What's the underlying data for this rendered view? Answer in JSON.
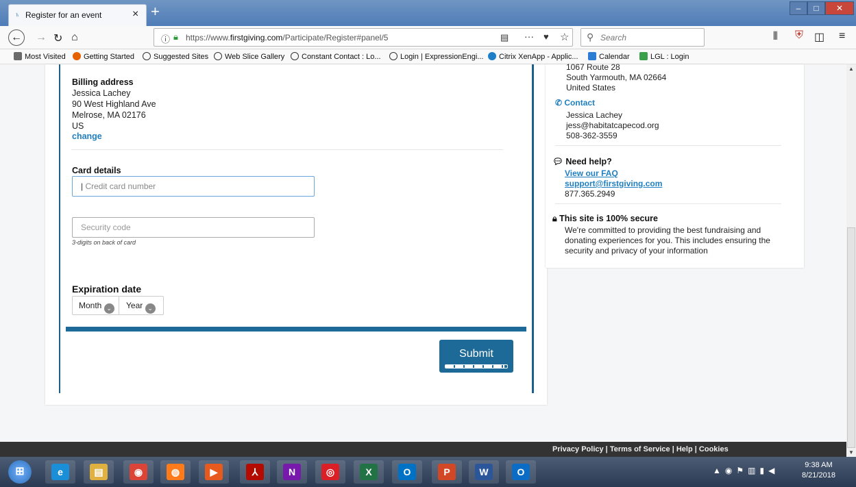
{
  "browser": {
    "tab_title": "Register for an event",
    "tab_close": "×",
    "new_tab": "+",
    "window_buttons": [
      "–",
      "□",
      "✕"
    ],
    "url_prefix": "https://www.",
    "url_domain": "firstgiving.com",
    "url_path": "/Participate/Register#panel/5",
    "search_placeholder": "Search",
    "nav_icons": [
      "back-icon",
      "forward-icon",
      "reload-icon",
      "home-icon"
    ]
  },
  "bookmarks": [
    {
      "label": "Most Visited",
      "color": "#6a6a6a"
    },
    {
      "label": "Getting Started",
      "color": "#e66000"
    },
    {
      "label": "Suggested Sites",
      "color": "#333333"
    },
    {
      "label": "Web Slice Gallery",
      "color": "#333333"
    },
    {
      "label": "Constant Contact : Lo...",
      "color": "#333333"
    },
    {
      "label": "Login | ExpressionEngi...",
      "color": "#333333"
    },
    {
      "label": "Citrix XenApp - Applic...",
      "color": "#1e7fc8"
    },
    {
      "label": "Calendar",
      "color": "#2b7cd3"
    },
    {
      "label": "LGL : Login",
      "color": "#3aa04a"
    }
  ],
  "billing": {
    "heading": "Billing address",
    "name": "Jessica Lachey",
    "street": "90 West Highland Ave",
    "city": "Melrose, MA 02176",
    "country": "US",
    "change_link": "change"
  },
  "card": {
    "heading": "Card details",
    "card_placeholder": "Credit card number",
    "security_placeholder": "Security code",
    "security_hint": "3-digits on back of card"
  },
  "expiration": {
    "heading": "Expiration date",
    "month_label": "Month",
    "year_label": "Year"
  },
  "submit": {
    "label": "Submit",
    "progress": 0.95
  },
  "sidebar": {
    "address_line1": "1067 Route 28",
    "address_line2": "South Yarmouth, MA 02664",
    "address_line3": "United States",
    "contact_heading": "Contact",
    "contact_name": "Jessica Lachey",
    "contact_email": "jess@habitatcapecod.org",
    "contact_phone": "508-362-3559",
    "help_heading": "Need help?",
    "faq_link": "View our FAQ",
    "support_link": "support@firstgiving.com",
    "support_phone": "877.365.2949",
    "secure_heading": "This site is 100% secure",
    "secure_text": "We're committed to providing the best fundraising and donating experiences for you. This includes ensuring the security and privacy of your information"
  },
  "footer": {
    "privacy": "Privacy Policy",
    "terms": "Terms of Service",
    "help": "Help",
    "cookies": "Cookies"
  },
  "taskbar": {
    "apps": [
      {
        "name": "windows-start-icon",
        "glyph": "⊞",
        "color": "#2f6fb8"
      },
      {
        "name": "internet-explorer-icon",
        "glyph": "e",
        "color": "#1a8fd8"
      },
      {
        "name": "file-explorer-icon",
        "glyph": "▤",
        "color": "#e0b040"
      },
      {
        "name": "chrome-icon",
        "glyph": "◉",
        "color": "#db4437"
      },
      {
        "name": "firefox-icon",
        "glyph": "◍",
        "color": "#ff7a18"
      },
      {
        "name": "media-player-icon",
        "glyph": "▶",
        "color": "#e65a1e"
      },
      {
        "name": "acrobat-icon",
        "glyph": "⅄",
        "color": "#b30b00"
      },
      {
        "name": "onenote-icon",
        "glyph": "N",
        "color": "#7719aa"
      },
      {
        "name": "creative-cloud-icon",
        "glyph": "◎",
        "color": "#da1f26"
      },
      {
        "name": "excel-icon",
        "glyph": "X",
        "color": "#217346"
      },
      {
        "name": "outlook-icon",
        "glyph": "O",
        "color": "#0072c6"
      },
      {
        "name": "powerpoint-icon",
        "glyph": "P",
        "color": "#d24726"
      },
      {
        "name": "word-icon",
        "glyph": "W",
        "color": "#2b579a"
      },
      {
        "name": "outlook-alt-icon",
        "glyph": "O",
        "color": "#0a6cc4"
      }
    ],
    "time": "9:38 AM",
    "date": "8/21/2018"
  }
}
